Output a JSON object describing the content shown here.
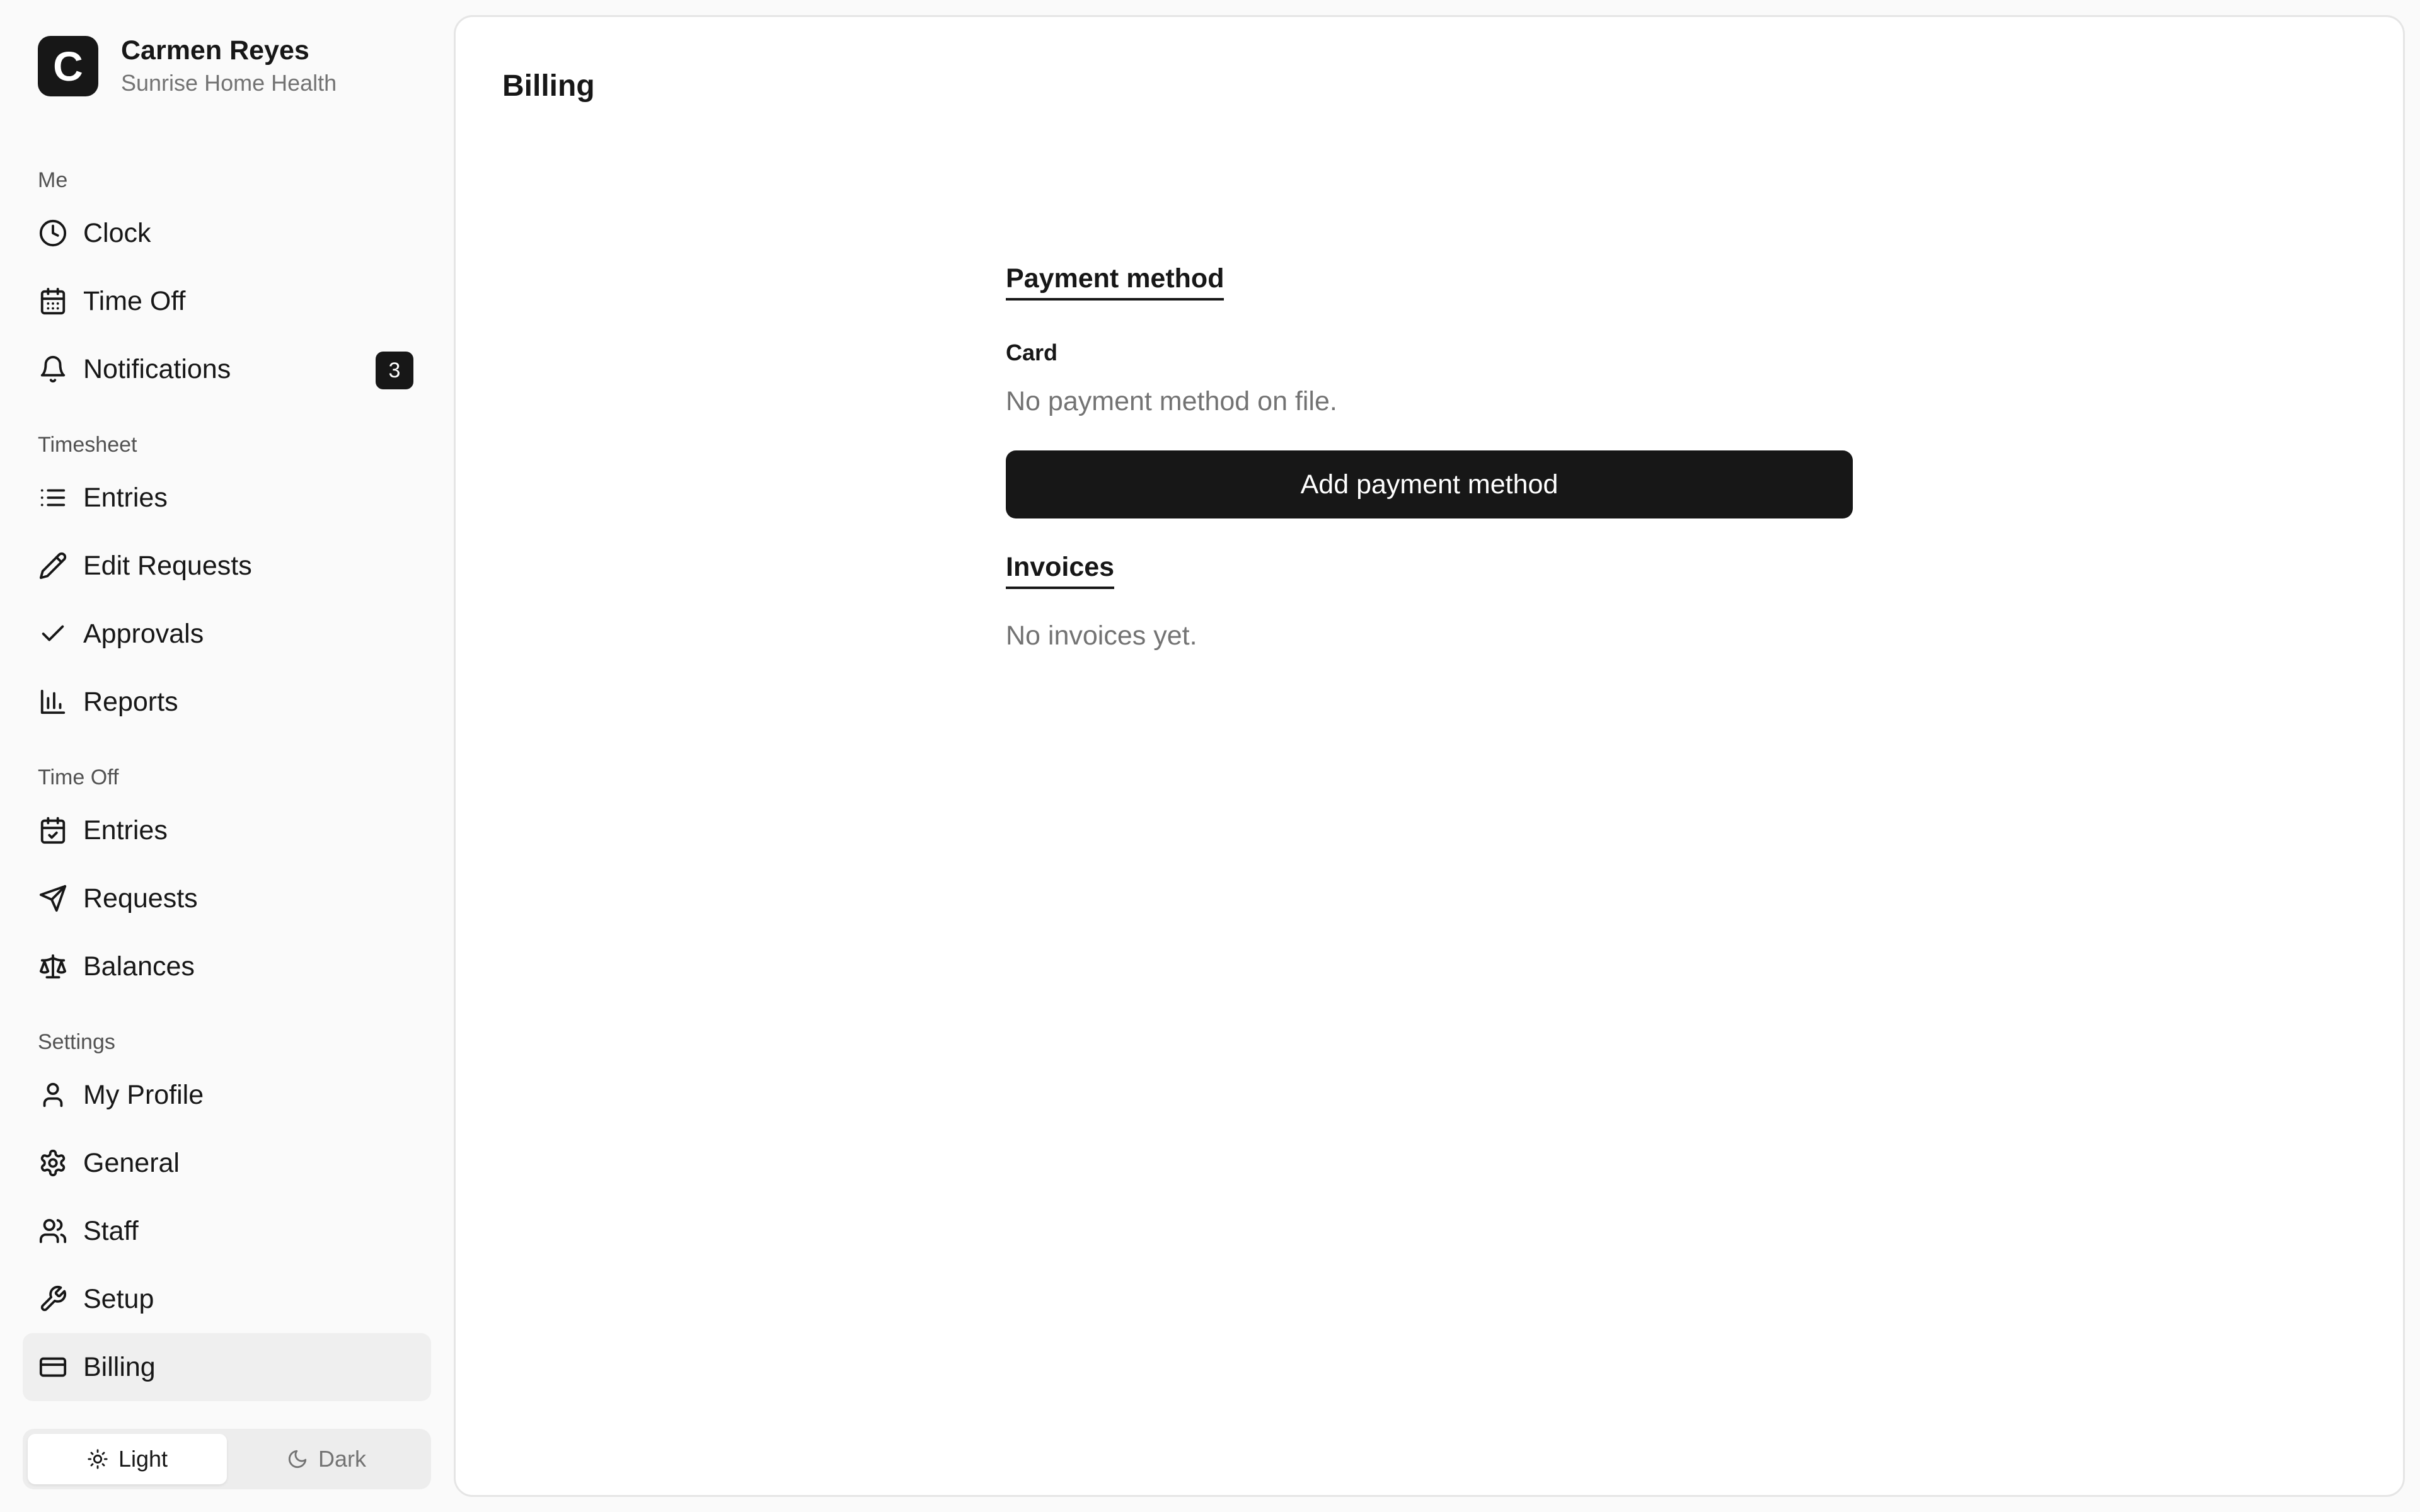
{
  "org": {
    "logo_letter": "C",
    "name": "Carmen Reyes",
    "subtitle": "Sunrise Home Health"
  },
  "sidebar": {
    "groups": [
      {
        "label": "Me",
        "items": [
          {
            "label": "Clock",
            "icon": "clock-icon"
          },
          {
            "label": "Time Off",
            "icon": "calendar-icon"
          },
          {
            "label": "Notifications",
            "icon": "bell-icon",
            "badge": "3"
          }
        ]
      },
      {
        "label": "Timesheet",
        "items": [
          {
            "label": "Entries",
            "icon": "list-icon"
          },
          {
            "label": "Edit Requests",
            "icon": "pencil-icon"
          },
          {
            "label": "Approvals",
            "icon": "check-icon"
          },
          {
            "label": "Reports",
            "icon": "bar-chart-icon"
          }
        ]
      },
      {
        "label": "Time Off",
        "items": [
          {
            "label": "Entries",
            "icon": "calendar-check-icon"
          },
          {
            "label": "Requests",
            "icon": "send-icon"
          },
          {
            "label": "Balances",
            "icon": "scale-icon"
          }
        ]
      },
      {
        "label": "Settings",
        "items": [
          {
            "label": "My Profile",
            "icon": "user-icon"
          },
          {
            "label": "General",
            "icon": "gear-icon"
          },
          {
            "label": "Staff",
            "icon": "users-icon"
          },
          {
            "label": "Setup",
            "icon": "wrench-icon"
          },
          {
            "label": "Billing",
            "icon": "credit-card-icon",
            "active": true
          }
        ]
      }
    ]
  },
  "theme": {
    "light_label": "Light",
    "dark_label": "Dark",
    "selected": "light"
  },
  "main": {
    "title": "Billing",
    "payment": {
      "section_title": "Payment method",
      "card_label": "Card",
      "empty_text": "No payment method on file.",
      "add_button_label": "Add payment method"
    },
    "invoices": {
      "section_title": "Invoices",
      "empty_text": "No invoices yet."
    }
  },
  "colors": {
    "accent": "#171717",
    "muted_text": "#737373",
    "background": "#fafafa",
    "panel": "#ffffff"
  }
}
